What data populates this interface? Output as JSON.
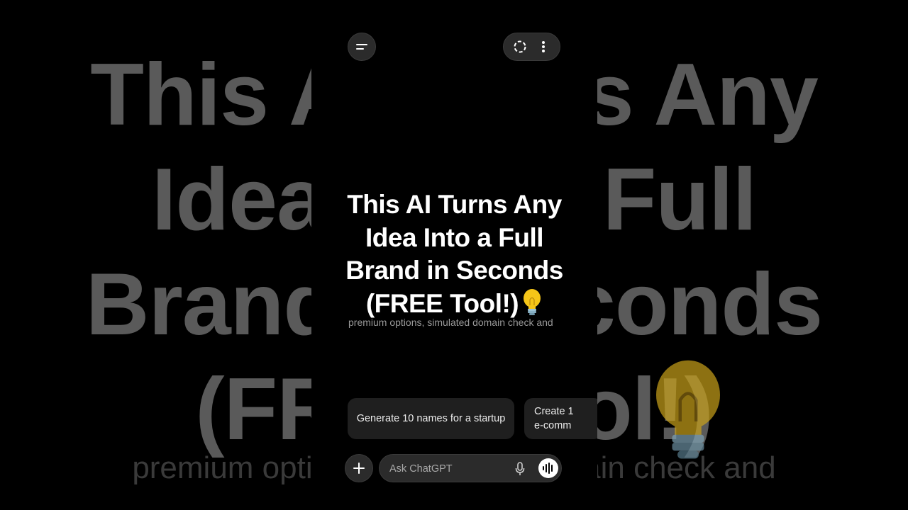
{
  "overlay": {
    "title_lines": [
      "This AI Turns Any",
      "Idea Into a Full",
      "Brand in Seconds",
      "(FREE Tool!)"
    ],
    "bulb_emoji": "lightbulb-icon"
  },
  "background": {
    "title_lines": [
      "This AI Turns Any",
      "Idea Into a Full",
      "Brand in Seconds",
      "(FREE Tool!)"
    ],
    "subtext": "premium options, simulated domain check and"
  },
  "app": {
    "subtext": "premium options, simulated domain check and",
    "suggestions": [
      {
        "lines": [
          "Generate 10 names for a startup"
        ]
      },
      {
        "lines": [
          "Create 1",
          "e-comm"
        ]
      }
    ],
    "composer": {
      "placeholder": "Ask ChatGPT"
    },
    "icons": {
      "menu": "menu-icon",
      "temporary_chat": "dashed-circle-icon",
      "more": "more-vertical-icon",
      "add": "plus-icon",
      "mic": "microphone-icon",
      "voice": "voice-mode-icon"
    }
  },
  "colors": {
    "background": "#000000",
    "surface": "#2b2b2b",
    "chip": "#1f1f1f",
    "text": "#ffffff"
  }
}
